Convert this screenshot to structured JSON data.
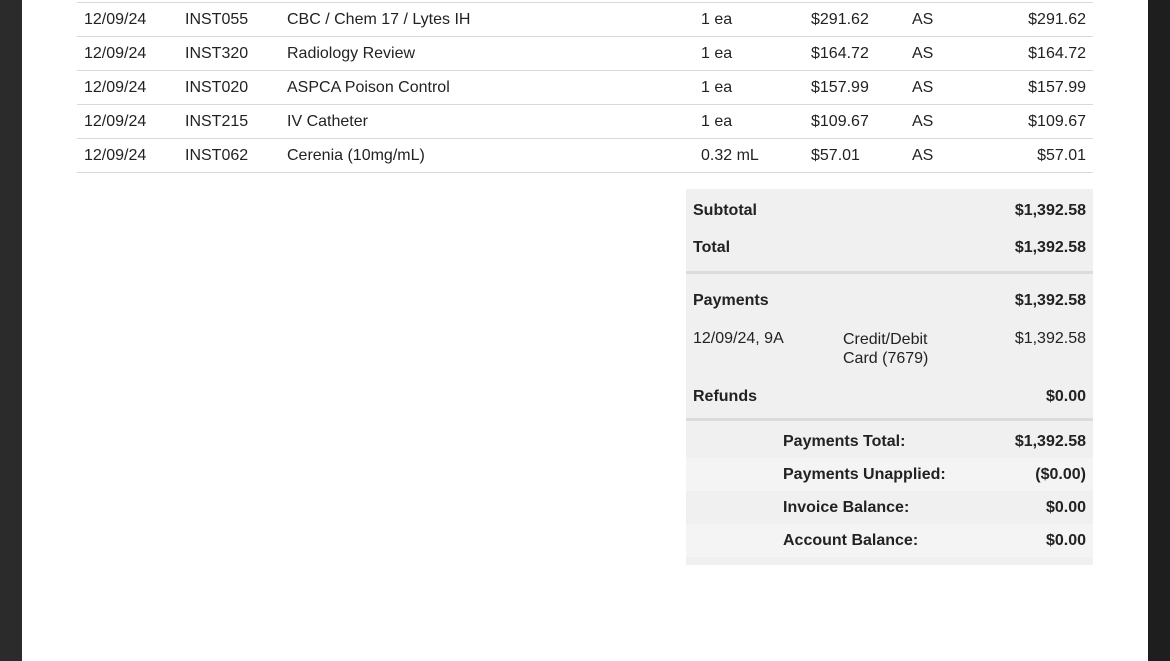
{
  "line_items": [
    {
      "date": "12/09/24",
      "code": "INST055",
      "description": "CBC / Chem 17 / Lytes IH",
      "qty": "1 ea",
      "price": "$291.62",
      "staff": "AS",
      "total": "$291.62"
    },
    {
      "date": "12/09/24",
      "code": "INST320",
      "description": "Radiology Review",
      "qty": "1 ea",
      "price": "$164.72",
      "staff": "AS",
      "total": "$164.72"
    },
    {
      "date": "12/09/24",
      "code": "INST020",
      "description": "ASPCA Poison Control",
      "qty": "1 ea",
      "price": "$157.99",
      "staff": "AS",
      "total": "$157.99"
    },
    {
      "date": "12/09/24",
      "code": "INST215",
      "description": "IV Catheter",
      "qty": "1 ea",
      "price": "$109.67",
      "staff": "AS",
      "total": "$109.67"
    },
    {
      "date": "12/09/24",
      "code": "INST062",
      "description": "Cerenia (10mg/mL)",
      "qty": "0.32 mL",
      "price": "$57.01",
      "staff": "AS",
      "total": "$57.01"
    }
  ],
  "summary": {
    "subtotal_label": "Subtotal",
    "subtotal": "$1,392.58",
    "total_label": "Total",
    "total": "$1,392.58",
    "payments_label": "Payments",
    "payments": "$1,392.58",
    "payment": {
      "date": "12/09/24, 9A",
      "method_line1": "Credit/Debit",
      "method_line2": "Card (7679)",
      "amount": "$1,392.58"
    },
    "refunds_label": "Refunds",
    "refunds": "$0.00",
    "balances": [
      {
        "label": "Payments Total:",
        "value": "$1,392.58"
      },
      {
        "label": "Payments Unapplied:",
        "value": "($0.00)"
      },
      {
        "label": "Invoice Balance:",
        "value": "$0.00"
      },
      {
        "label": "Account Balance:",
        "value": "$0.00"
      }
    ]
  }
}
